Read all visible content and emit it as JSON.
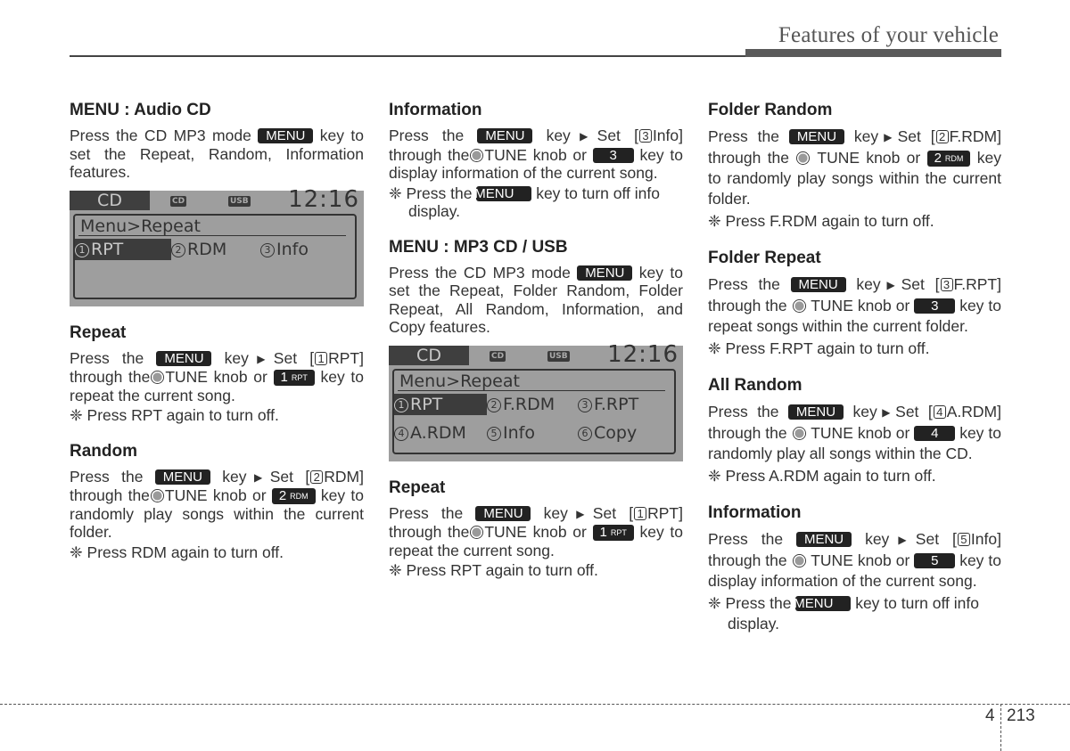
{
  "header": {
    "title": "Features of your vehicle"
  },
  "keys": {
    "menu": "MENU",
    "tune": "TUNE",
    "rpt_num": "1",
    "rpt_sub": "RPT",
    "rdm_num": "2",
    "rdm_sub": "RDM",
    "k3": "3",
    "k4": "4",
    "k5": "5"
  },
  "col1": {
    "audio_cd": {
      "title": "MENU : Audio CD",
      "p_before": "Press the CD MP3 mode",
      "p_after": "key to set the Repeat, Random, Information features."
    },
    "lcd": {
      "mode": "CD",
      "icon_cd": "CD",
      "icon_usb": "USB",
      "clock": "12:16",
      "crumb": "Menu>Repeat",
      "options": [
        {
          "num": "1",
          "label": "RPT"
        },
        {
          "num": "2",
          "label": "RDM"
        },
        {
          "num": "3",
          "label": "Info"
        }
      ]
    },
    "repeat": {
      "title": "Repeat",
      "t1": "Press the",
      "t2": "key",
      "t3": "Set [",
      "box": "1",
      "t4": "RPT]",
      "t5": "through the",
      "t6": "knob or",
      "t7": "key to repeat the current song.",
      "note": "❈ Press RPT again to turn off."
    },
    "random": {
      "title": "Random",
      "t1": "Press the",
      "t2": "key",
      "t3": "Set [",
      "box": "2",
      "t4": "RDM]",
      "t5": "through the",
      "t6": "knob or",
      "t7": "key to randomly play songs within the current folder.",
      "note": "❈ Press RDM again to turn off."
    }
  },
  "col2": {
    "information": {
      "title": "Information",
      "t1": "Press the",
      "t2": "key",
      "t3": "Set [",
      "box": "3",
      "t4": "Info]",
      "t5": "through the",
      "t6": "knob or",
      "t7": "key to display information of the current song.",
      "note_a": "❈ Press the",
      "note_b": "key to turn off info display."
    },
    "mp3": {
      "title": "MENU : MP3 CD / USB",
      "p_before": "Press the CD MP3 mode",
      "p_after": "key to set the Repeat, Folder Random, Folder Repeat, All Random, Information, and Copy features."
    },
    "lcd": {
      "mode": "CD",
      "icon_cd": "CD",
      "icon_usb": "USB",
      "clock": "12:16",
      "crumb": "Menu>Repeat",
      "options": [
        {
          "num": "1",
          "label": "RPT"
        },
        {
          "num": "2",
          "label": "F.RDM"
        },
        {
          "num": "3",
          "label": "F.RPT"
        },
        {
          "num": "4",
          "label": "A.RDM"
        },
        {
          "num": "5",
          "label": "Info"
        },
        {
          "num": "6",
          "label": "Copy"
        }
      ]
    },
    "repeat": {
      "title": "Repeat",
      "t1": "Press the",
      "t2": "key",
      "t3": "Set [",
      "box": "1",
      "t4": "RPT]",
      "t5": "through the",
      "t6": "knob or",
      "t7": "key to repeat the current song.",
      "note": "❈ Press RPT again to turn off."
    }
  },
  "col3": {
    "folder_random": {
      "title": "Folder Random",
      "t1": "Press the",
      "t2": "key",
      "t3": "Set [",
      "box": "2",
      "t4": "F.RDM]",
      "t5": "through the",
      "t6": "knob or",
      "t7": "key to randomly play songs within the current folder.",
      "note": "❈ Press F.RDM again to turn off."
    },
    "folder_repeat": {
      "title": "Folder Repeat",
      "t1": "Press the",
      "t2": "key",
      "t3": "Set [",
      "box": "3",
      "t4": "F.RPT]",
      "t5": "through the",
      "t6": "knob or",
      "t7": "key to repeat songs within the current folder.",
      "note": "❈ Press F.RPT again to turn off."
    },
    "all_random": {
      "title": "All Random",
      "t1": "Press the",
      "t2": "key",
      "t3": "Set [",
      "box": "4",
      "t4": "A.RDM]",
      "t5": "through the",
      "t6": "knob or",
      "t7": "key to randomly play all songs within the CD.",
      "note": "❈ Press A.RDM again to turn off."
    },
    "information": {
      "title": "Information",
      "t1": "Press the",
      "t2": "key",
      "t3": "Set [",
      "box": "5",
      "t4": "Info]",
      "t5": "through the",
      "t6": "knob or",
      "t7": "key to display information of the current song.",
      "note_a": "❈ Press the",
      "note_b": "key to turn off info display."
    }
  },
  "footer": {
    "chapter": "4",
    "page": "213"
  }
}
